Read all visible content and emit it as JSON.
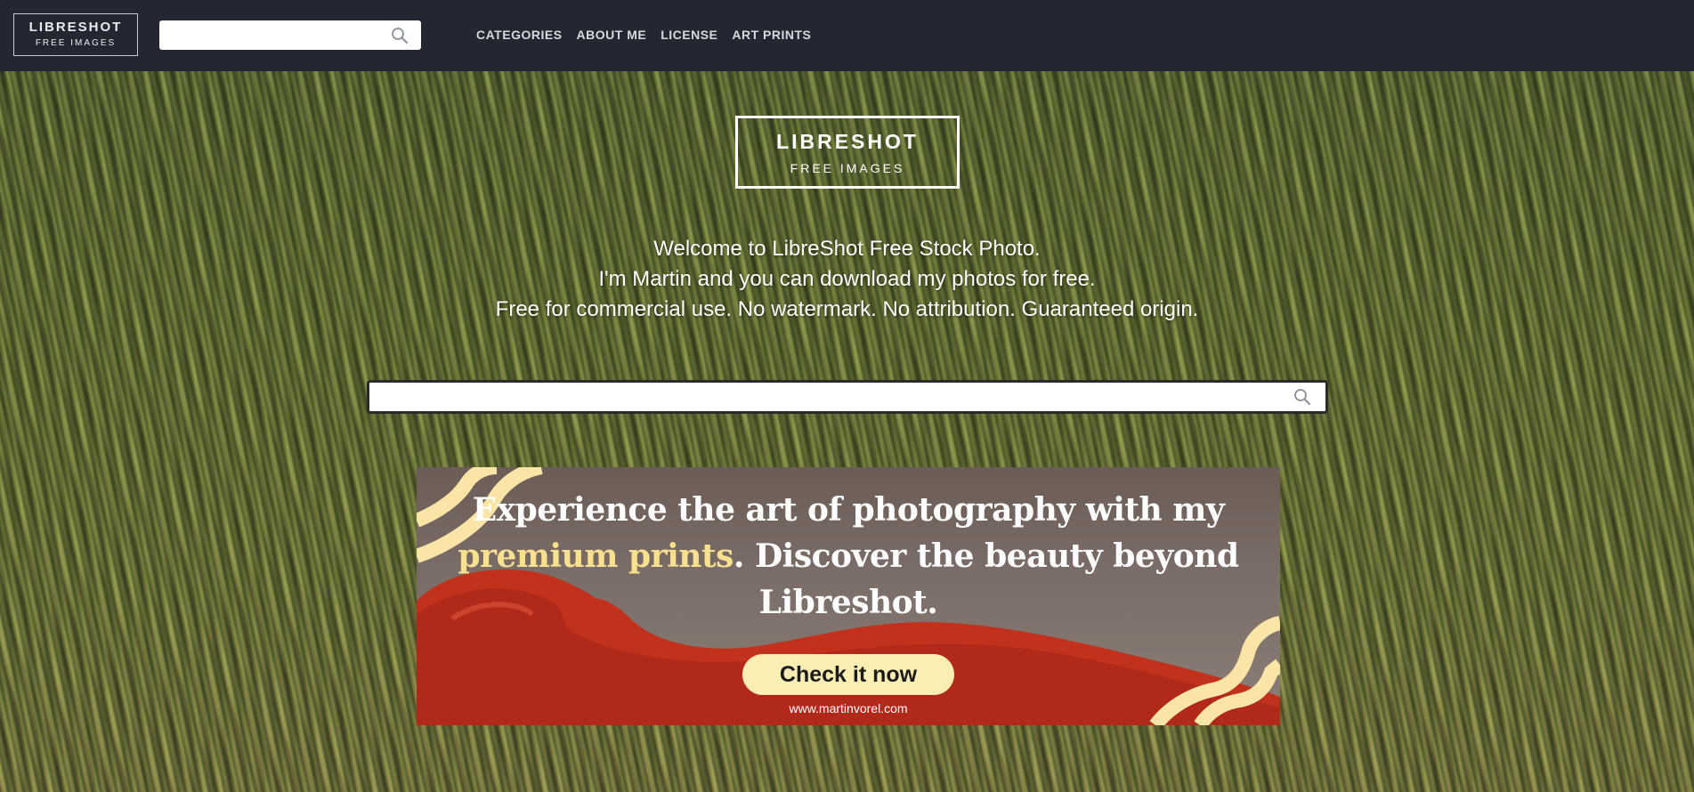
{
  "nav": {
    "logo_title": "LIBRESHOT",
    "logo_subtitle": "FREE IMAGES",
    "search_placeholder": "",
    "links": [
      {
        "label": "CATEGORIES"
      },
      {
        "label": "ABOUT ME"
      },
      {
        "label": "LICENSE"
      },
      {
        "label": "ART PRINTS"
      }
    ]
  },
  "hero": {
    "logo_title": "LIBRESHOT",
    "logo_subtitle": "FREE IMAGES",
    "lines": [
      "Welcome to LibreShot Free Stock Photo.",
      "I'm Martin and you can download my photos for free.",
      "Free for commercial use. No watermark. No attribution. Guaranteed origin."
    ],
    "search_placeholder": ""
  },
  "banner": {
    "headline_part1": "Experience the art of photography with my",
    "headline_highlight": "premium prints",
    "headline_part2": ". Discover the beauty beyond",
    "headline_part3": "Libreshot.",
    "cta_label": "Check it now",
    "url": "www.martinvorel.com"
  },
  "colors": {
    "topbar_bg": "#222732",
    "banner_highlight": "#f7e08e",
    "cta_bg": "#fbeeb2"
  },
  "icons": {
    "search": "search-icon"
  }
}
